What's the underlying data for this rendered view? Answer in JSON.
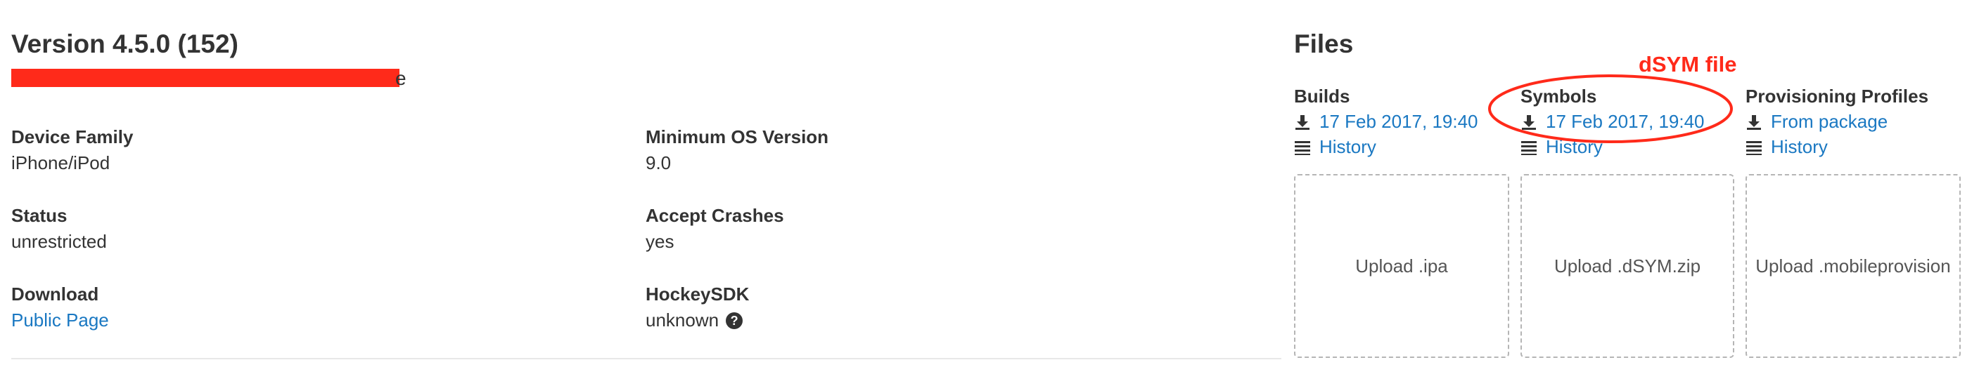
{
  "version": {
    "title": "Version 4.5.0 (152)",
    "subtitle_visible_fragment": "e"
  },
  "details": {
    "device_family": {
      "label": "Device Family",
      "value": "iPhone/iPod"
    },
    "min_os": {
      "label": "Minimum OS Version",
      "value": "9.0"
    },
    "status": {
      "label": "Status",
      "value": "unrestricted"
    },
    "accept_crashes": {
      "label": "Accept Crashes",
      "value": "yes"
    },
    "download": {
      "label": "Download",
      "link": "Public Page"
    },
    "hockeysdk": {
      "label": "HockeySDK",
      "value": "unknown",
      "help_icon": "question-circle-icon"
    }
  },
  "files": {
    "title": "Files",
    "builds": {
      "label": "Builds",
      "download": "17 Feb 2017, 19:40",
      "history": "History",
      "upload": "Upload .ipa"
    },
    "symbols": {
      "label": "Symbols",
      "download": "17 Feb 2017, 19:40",
      "history": "History",
      "upload": "Upload .dSYM.zip"
    },
    "profiles": {
      "label": "Provisioning Profiles",
      "download": "From package",
      "history": "History",
      "upload": "Upload .mobileprovision"
    }
  },
  "annotation": {
    "text": "dSYM file",
    "color": "#ff2a1a"
  },
  "colors": {
    "link": "#1a78c2",
    "text": "#333333",
    "redaction": "#ff2a1a"
  },
  "icons": {
    "download": "download-icon",
    "history": "list-icon"
  }
}
